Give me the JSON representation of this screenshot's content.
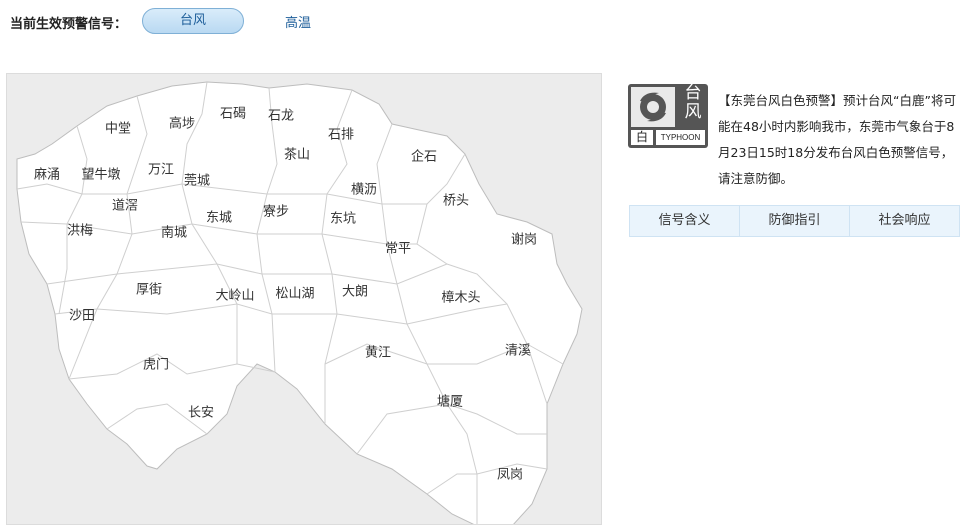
{
  "header": {
    "label": "当前生效预警信号：",
    "active_tab": "台风",
    "other_tab": "高温"
  },
  "map": {
    "towns": [
      {
        "id": "zhongtang",
        "name": "中堂"
      },
      {
        "id": "gaobu",
        "name": "高埗"
      },
      {
        "id": "shijie",
        "name": "石碣"
      },
      {
        "id": "shilong",
        "name": "石龙"
      },
      {
        "id": "shipai",
        "name": "石排"
      },
      {
        "id": "chashan",
        "name": "茶山"
      },
      {
        "id": "qishi",
        "name": "企石"
      },
      {
        "id": "mayong",
        "name": "麻涌"
      },
      {
        "id": "wangniudun",
        "name": "望牛墩"
      },
      {
        "id": "wanjiang",
        "name": "万江"
      },
      {
        "id": "guancheng",
        "name": "莞城"
      },
      {
        "id": "hengli",
        "name": "横沥"
      },
      {
        "id": "daojiao",
        "name": "道滘"
      },
      {
        "id": "qiaotou",
        "name": "桥头"
      },
      {
        "id": "dongcheng",
        "name": "东城"
      },
      {
        "id": "liaobu",
        "name": "寮步"
      },
      {
        "id": "dongkeng",
        "name": "东坑"
      },
      {
        "id": "hongmei",
        "name": "洪梅"
      },
      {
        "id": "nancheng",
        "name": "南城"
      },
      {
        "id": "xiegang",
        "name": "谢岗"
      },
      {
        "id": "changping",
        "name": "常平"
      },
      {
        "id": "houjie",
        "name": "厚街"
      },
      {
        "id": "dalingshan",
        "name": "大岭山"
      },
      {
        "id": "songshanhu",
        "name": "松山湖"
      },
      {
        "id": "dalang",
        "name": "大朗"
      },
      {
        "id": "zhangmutou",
        "name": "樟木头"
      },
      {
        "id": "shatian",
        "name": "沙田"
      },
      {
        "id": "huangjiang",
        "name": "黄江"
      },
      {
        "id": "qingxi",
        "name": "清溪"
      },
      {
        "id": "humen",
        "name": "虎门"
      },
      {
        "id": "changan",
        "name": "长安"
      },
      {
        "id": "tangxia",
        "name": "塘厦"
      },
      {
        "id": "fenggang",
        "name": "凤岗"
      }
    ],
    "land_color": "#ffffff",
    "sea_color": "#ececec",
    "border_color": "#c8c8c8"
  },
  "signal": {
    "icon": "typhoon-icon",
    "big_text": "台风",
    "level_text": "白",
    "english": "TYPHOON",
    "description": "【东莞台风白色预警】预计台风“白鹿”将可能在48小时内影响我市，东莞市气象台于8月23日15时18分发布台风白色预警信号，请注意防御。"
  },
  "info_tabs": [
    "信号含义",
    "防御指引",
    "社会响应"
  ]
}
